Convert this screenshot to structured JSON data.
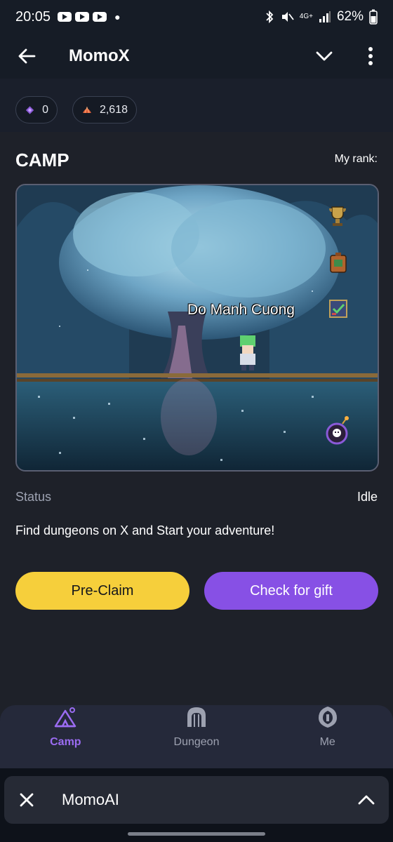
{
  "status_bar": {
    "time": "20:05",
    "battery": "62%",
    "network": "4G+",
    "icons": [
      "youtube-icon",
      "youtube-icon",
      "youtube-icon",
      "bluetooth-icon",
      "mute-icon",
      "signal-icon",
      "battery-icon"
    ]
  },
  "header": {
    "title": "MomoX",
    "back_icon": "arrow-left-icon",
    "collapse_icon": "chevron-down-icon",
    "menu_icon": "more-vertical-icon"
  },
  "currency": {
    "gems": "0",
    "shells": "2,618"
  },
  "camp": {
    "title": "CAMP",
    "rank_label": "My rank:",
    "player_name": "Do Manh Cuong",
    "scene_icons": [
      "trophy-icon",
      "backpack-icon",
      "checklist-icon",
      "bomb-skull-icon"
    ]
  },
  "status": {
    "label": "Status",
    "value": "Idle"
  },
  "tagline": "Find dungeons on X and Start your adventure!",
  "buttons": {
    "pre_claim": "Pre-Claim",
    "check_gift": "Check for gift"
  },
  "nav": {
    "items": [
      {
        "label": "Camp",
        "icon": "camp-icon",
        "active": true
      },
      {
        "label": "Dungeon",
        "icon": "dungeon-gate-icon",
        "active": false
      },
      {
        "label": "Me",
        "icon": "helmet-icon",
        "active": false
      }
    ]
  },
  "overlay": {
    "title": "MomoAI",
    "close_icon": "close-icon",
    "expand_icon": "chevron-up-icon"
  },
  "colors": {
    "accent_purple": "#8750e5",
    "accent_yellow": "#f6cf3b",
    "panel_bg": "#1e2129",
    "header_bg": "#161c26"
  }
}
